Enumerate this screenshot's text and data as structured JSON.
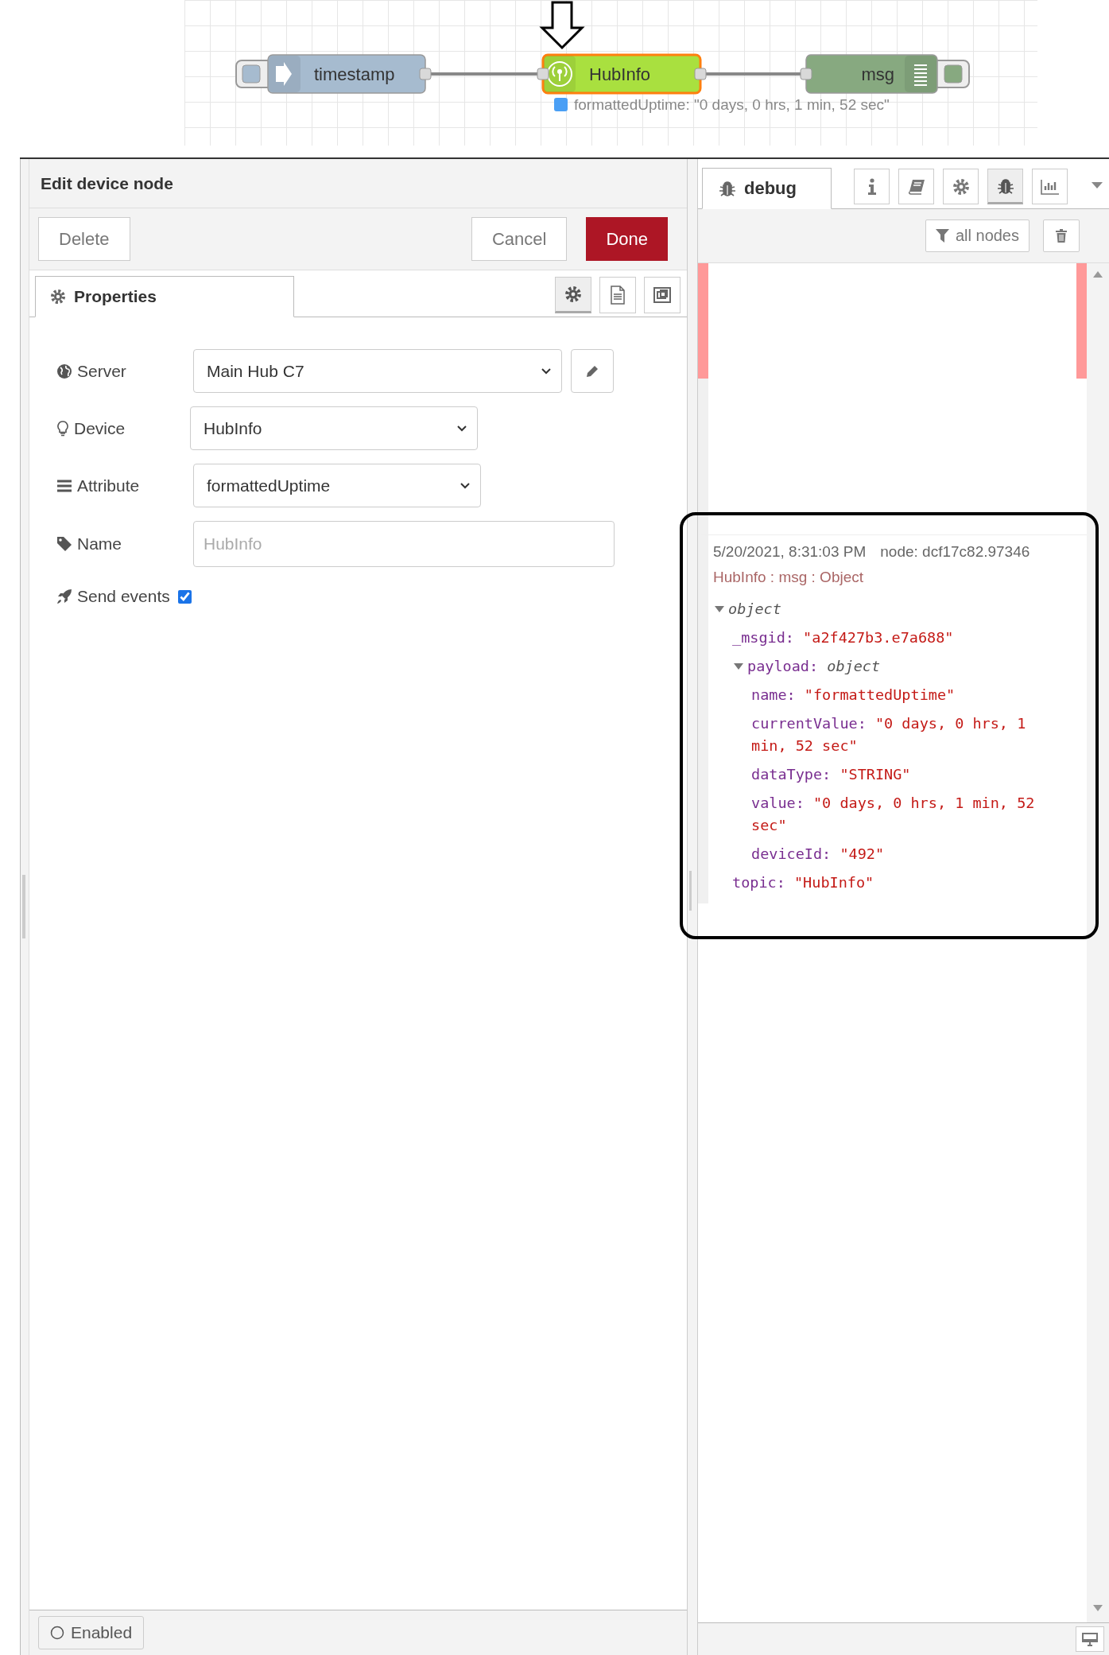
{
  "flow": {
    "nodes": [
      {
        "kind": "inject",
        "label": "timestamp",
        "selected": false
      },
      {
        "kind": "device",
        "label": "HubInfo",
        "selected": true
      },
      {
        "kind": "debug",
        "label": "msg",
        "selected": false
      }
    ],
    "status": "formattedUptime: \"0 days, 0 hrs, 1 min, 52 sec\""
  },
  "editor": {
    "title": "Edit device node",
    "delete": "Delete",
    "cancel": "Cancel",
    "done": "Done",
    "tabs": [
      {
        "label": "Properties",
        "selected": true
      }
    ],
    "tab_icons": [
      {
        "kind": "settings",
        "selected": true
      },
      {
        "kind": "description",
        "selected": false
      },
      {
        "kind": "appearance",
        "selected": false
      }
    ],
    "fields": [
      {
        "kind": "select",
        "label": "Server",
        "value": "Main Hub C7",
        "edit_button": true
      },
      {
        "kind": "select",
        "label": "Device",
        "value": "HubInfo",
        "edit_button": false
      },
      {
        "kind": "select",
        "label": "Attribute",
        "value": "formattedUptime",
        "edit_button": false
      },
      {
        "kind": "text",
        "label": "Name",
        "placeholder": "HubInfo"
      },
      {
        "kind": "checkbox",
        "label": "Send events",
        "checked": true
      }
    ],
    "enabled_button": "Enabled"
  },
  "debug": {
    "tabs": [
      {
        "label": "debug",
        "selected": true
      }
    ],
    "tool_buttons": [
      {
        "kind": "info",
        "selected": false
      },
      {
        "kind": "help",
        "selected": false
      },
      {
        "kind": "config",
        "selected": false
      },
      {
        "kind": "debug",
        "selected": true
      },
      {
        "kind": "dashboard",
        "selected": false
      }
    ],
    "filter": "all nodes",
    "message": {
      "timestamp": "5/20/2021, 8:31:03 PM",
      "node": "node: dcf17c82.97346",
      "header": "HubInfo : msg : Object",
      "tree": {
        "label": "object",
        "expanded": true,
        "children": [
          {
            "key": "_msgid:",
            "value": "\"a2f427b3.e7a688\""
          },
          {
            "key": "payload:",
            "label": "object",
            "expanded": true,
            "children": [
              {
                "key": "name:",
                "value": "\"formattedUptime\""
              },
              {
                "key": "currentValue:",
                "value": "\"0 days, 0 hrs, 1 min, 52 sec\""
              },
              {
                "key": "dataType:",
                "value": "\"STRING\""
              },
              {
                "key": "value:",
                "value": "\"0 days, 0 hrs, 1 min, 52 sec\""
              },
              {
                "key": "deviceId:",
                "value": "\"492\""
              }
            ]
          },
          {
            "key": "topic:",
            "value": "\"HubInfo\""
          }
        ]
      }
    }
  }
}
